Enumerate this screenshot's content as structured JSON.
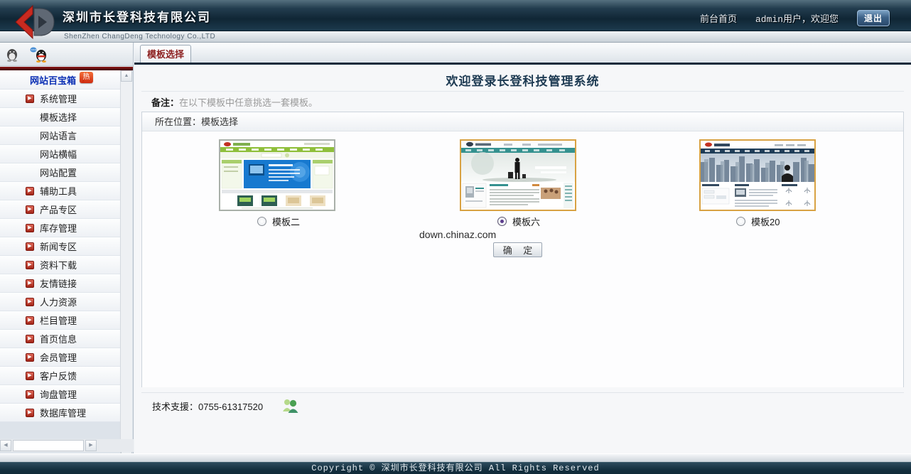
{
  "header": {
    "company_name": "深圳市长登科技有限公司",
    "company_name_en": "ShenZhen ChangDeng Technology Co.,LTD",
    "front_page_link": "前台首页",
    "welcome_text": "admin用户，欢迎您",
    "logout_label": "退出"
  },
  "sidebar": {
    "toolbox_label": "网站百宝箱",
    "hot_badge": "热",
    "items": [
      {
        "label": "系统管理",
        "has_icon": true
      },
      {
        "label": "模板选择",
        "has_icon": false
      },
      {
        "label": "网站语言",
        "has_icon": false
      },
      {
        "label": "网站横幅",
        "has_icon": false
      },
      {
        "label": "网站配置",
        "has_icon": false
      },
      {
        "label": "辅助工具",
        "has_icon": true
      },
      {
        "label": "产品专区",
        "has_icon": true
      },
      {
        "label": "库存管理",
        "has_icon": true
      },
      {
        "label": "新闻专区",
        "has_icon": true
      },
      {
        "label": "资料下载",
        "has_icon": true
      },
      {
        "label": "友情链接",
        "has_icon": true
      },
      {
        "label": "人力资源",
        "has_icon": true
      },
      {
        "label": "栏目管理",
        "has_icon": true
      },
      {
        "label": "首页信息",
        "has_icon": true
      },
      {
        "label": "会员管理",
        "has_icon": true
      },
      {
        "label": "客户反馈",
        "has_icon": true
      },
      {
        "label": "询盘管理",
        "has_icon": true
      },
      {
        "label": "数据库管理",
        "has_icon": true
      }
    ]
  },
  "tabs": {
    "active_tab": "模板选择"
  },
  "main": {
    "title": "欢迎登录长登科技管理系统",
    "note_label": "备注：",
    "note_text": "在以下模板中任意挑选一套模板。",
    "location_text": "所在位置：模板选择",
    "templates": [
      {
        "label": "模板二",
        "selected": false
      },
      {
        "label": "模板六",
        "selected": true
      },
      {
        "label": "模板20",
        "selected": false
      }
    ],
    "watermark": "down.chinaz.com",
    "confirm_label": "确 定",
    "support_text": "技术支援：0755-61317520"
  },
  "footer": {
    "copyright": "Copyright © 深圳市长登科技有限公司 All Rights Reserved"
  },
  "icons": {
    "sidebar_item_icon": "red-arrow-icon",
    "contact_icons": [
      "qq-gray-icon",
      "qq-color-icon"
    ],
    "support_icon": "msn-messenger-icon"
  },
  "colors": {
    "header_navy": "#132b3c",
    "tab_text_red": "#8c1f1f",
    "menu_root_blue": "#0b2fb4",
    "hot_badge_red": "#cf2c10",
    "selected_thumb_border": "#d8a243",
    "radio_selected_dot": "#5b3b8c",
    "footer_navy": "#14303f"
  }
}
